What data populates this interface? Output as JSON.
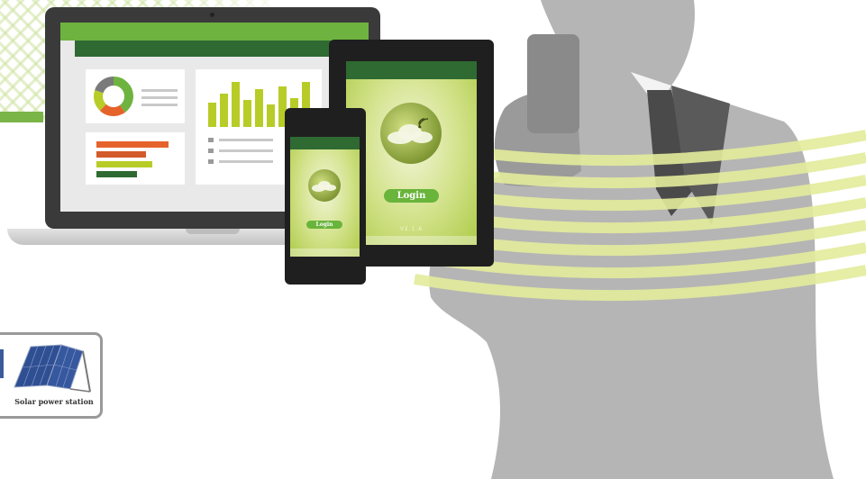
{
  "colors": {
    "brand_green": "#6eb33f",
    "dark_green": "#2f6a32",
    "lime": "#b8cc27",
    "silhouette_gray": "#b5b5b5",
    "stripe_yellow": "#e4ec9c",
    "device_black": "#1f1f1f"
  },
  "devices": {
    "tablet": {
      "login_label": "Login",
      "version": "V2.1.6"
    },
    "phone": {
      "login_label": "Login"
    }
  },
  "laptop_dashboard": {
    "donut_segments": [
      {
        "color": "#6eb33f",
        "fraction": 0.4
      },
      {
        "color": "#e5632b",
        "fraction": 0.22
      },
      {
        "color": "#b8cc27",
        "fraction": 0.18
      },
      {
        "color": "#7a7a7a",
        "fraction": 0.2
      }
    ],
    "bar_levels": [
      0.55,
      0.75,
      1.0,
      0.6,
      0.85,
      0.5,
      0.9,
      0.65,
      1.0
    ]
  },
  "solar_card": {
    "label": "Solar power station",
    "icon": "solar-panel-icon"
  }
}
